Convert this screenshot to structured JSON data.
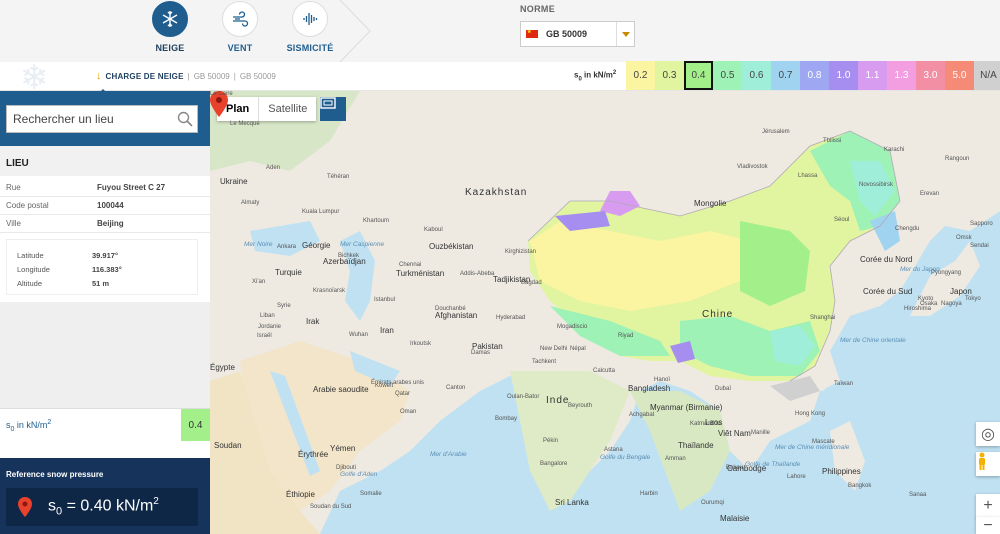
{
  "nav": {
    "items": [
      {
        "label": "NEIGE",
        "icon": "snowflake-icon",
        "active": true
      },
      {
        "label": "VENT",
        "icon": "wind-icon",
        "active": false
      },
      {
        "label": "SISMICITÉ",
        "icon": "seismic-wave-icon",
        "active": false
      }
    ]
  },
  "norme": {
    "label": "NORME",
    "selected": "GB 50009",
    "flag": "china-flag-icon"
  },
  "subbar": {
    "charge_label": "CHARGE DE NEIGE",
    "crumb1": "GB 50009",
    "crumb2": "GB 50009",
    "s0_unit_label": "s0 in kN/m2"
  },
  "legend": [
    {
      "value": "0.2",
      "color": "#fbf4a0"
    },
    {
      "value": "0.3",
      "color": "#e1f4a0"
    },
    {
      "value": "0.4",
      "color": "#a3f08a",
      "selected": true
    },
    {
      "value": "0.5",
      "color": "#9ef2b5"
    },
    {
      "value": "0.6",
      "color": "#9feed9"
    },
    {
      "value": "0.7",
      "color": "#9fd3ef"
    },
    {
      "value": "0.8",
      "color": "#9ea7f2"
    },
    {
      "value": "1.0",
      "color": "#a68ef0"
    },
    {
      "value": "1.1",
      "color": "#d79cf0"
    },
    {
      "value": "1.3",
      "color": "#f39ee0"
    },
    {
      "value": "3.0",
      "color": "#f38fa5"
    },
    {
      "value": "5.0",
      "color": "#f58a77"
    },
    {
      "value": "N/A",
      "color": "#d0d0d0"
    }
  ],
  "search": {
    "placeholder": "Rechercher un lieu"
  },
  "lieu": {
    "title": "LIEU",
    "rows": [
      {
        "key": "Rue",
        "value": "Fuyou Street C 27"
      },
      {
        "key": "Code postal",
        "value": "100044"
      },
      {
        "key": "Ville",
        "value": "Beijing"
      }
    ],
    "coords": [
      {
        "key": "Latitude",
        "value": "39.917°"
      },
      {
        "key": "Longitude",
        "value": "116.383°"
      },
      {
        "key": "Altitude",
        "value": "51 m"
      }
    ]
  },
  "result": {
    "s0_label": "s0 in kN/m2",
    "s0_value": "0.4",
    "reference_title": "Reference snow pressure",
    "reference_value": "s0 = 0.40 kN/m2"
  },
  "map": {
    "type_plan": "Plan",
    "type_satellite": "Satellite",
    "labels": [
      {
        "text": "Kazakhstan"
      },
      {
        "text": "Mongolie"
      },
      {
        "text": "Chine"
      },
      {
        "text": "Inde"
      },
      {
        "text": "Ukraine"
      },
      {
        "text": "Géorgie"
      },
      {
        "text": "Azerbaïdjan"
      },
      {
        "text": "Ouzbékistan"
      },
      {
        "text": "Turkménistan"
      },
      {
        "text": "Kirghizistan"
      },
      {
        "text": "Tadjikistan"
      },
      {
        "text": "Turquie"
      },
      {
        "text": "Syrie"
      },
      {
        "text": "Liban"
      },
      {
        "text": "Israël"
      },
      {
        "text": "Jordanie"
      },
      {
        "text": "Irak"
      },
      {
        "text": "Iran"
      },
      {
        "text": "Afghanistan"
      },
      {
        "text": "Pakistan"
      },
      {
        "text": "Égypte"
      },
      {
        "text": "Arabie saoudite"
      },
      {
        "text": "Koweït"
      },
      {
        "text": "Qatar"
      },
      {
        "text": "Émirats arabes unis"
      },
      {
        "text": "Oman"
      },
      {
        "text": "Soudan"
      },
      {
        "text": "Érythrée"
      },
      {
        "text": "Yémen"
      },
      {
        "text": "Djibouti"
      },
      {
        "text": "Éthiopie"
      },
      {
        "text": "Soudan du Sud"
      },
      {
        "text": "Somalie"
      },
      {
        "text": "Népal"
      },
      {
        "text": "New Delhi"
      },
      {
        "text": "Bangladesh"
      },
      {
        "text": "Myanmar (Birmanie)"
      },
      {
        "text": "Bombay"
      },
      {
        "text": "Bangalore"
      },
      {
        "text": "Sri Lanka"
      },
      {
        "text": "Thaïlande"
      },
      {
        "text": "Laos"
      },
      {
        "text": "Viêt Nam"
      },
      {
        "text": "Cambodge"
      },
      {
        "text": "Malaisie"
      },
      {
        "text": "Philippines"
      },
      {
        "text": "Taïwan"
      },
      {
        "text": "Hong Kong"
      },
      {
        "text": "Shanghai"
      },
      {
        "text": "Corée du Nord"
      },
      {
        "text": "Corée du Sud"
      },
      {
        "text": "Japon"
      },
      {
        "text": "Tokyo"
      },
      {
        "text": "Osaka"
      },
      {
        "text": "Kyoto"
      },
      {
        "text": "Hiroshima"
      },
      {
        "text": "Sapporo"
      },
      {
        "text": "Nagoya"
      },
      {
        "text": "Sendai"
      },
      {
        "text": "Mer Caspienne"
      },
      {
        "text": "Mer Noire"
      },
      {
        "text": "Mer du Japon"
      },
      {
        "text": "Mer de Chine orientale"
      },
      {
        "text": "Mer de Chine méridionale"
      },
      {
        "text": "Golfe du Bengale"
      },
      {
        "text": "Mer d'Arabie"
      },
      {
        "text": "Golfe de Thaïlande"
      },
      {
        "text": "Golfe d'Aden"
      },
      {
        "text": "Le Caire"
      },
      {
        "text": "Le Mecque"
      },
      {
        "text": "Téhéran"
      },
      {
        "text": "Kaboul"
      },
      {
        "text": "Bagdad"
      },
      {
        "text": "Riyad"
      },
      {
        "text": "Dubaï"
      },
      {
        "text": "Mascate"
      },
      {
        "text": "Sanaa"
      },
      {
        "text": "Aden"
      },
      {
        "text": "Khartoum"
      },
      {
        "text": "Addis-Abeba"
      },
      {
        "text": "Mogadiscio"
      },
      {
        "text": "Hanoï"
      },
      {
        "text": "Manille"
      },
      {
        "text": "Bangkok"
      },
      {
        "text": "Rangoun"
      },
      {
        "text": "Kuala Lumpur"
      },
      {
        "text": "Chennai"
      },
      {
        "text": "Hyderabad"
      },
      {
        "text": "Calcutta"
      },
      {
        "text": "Katmandou"
      },
      {
        "text": "Lahore"
      },
      {
        "text": "Karachi"
      },
      {
        "text": "Almaty"
      },
      {
        "text": "Bichkek"
      },
      {
        "text": "Douchanbé"
      },
      {
        "text": "Tachkent"
      },
      {
        "text": "Achgabat"
      },
      {
        "text": "Bakou"
      },
      {
        "text": "Tbilissi"
      },
      {
        "text": "Erevan"
      },
      {
        "text": "Ankara"
      },
      {
        "text": "Istanbul"
      },
      {
        "text": "Damas"
      },
      {
        "text": "Beyrouth"
      },
      {
        "text": "Amman"
      },
      {
        "text": "Jérusalem"
      },
      {
        "text": "Novossibirsk"
      },
      {
        "text": "Omsk"
      },
      {
        "text": "Krasnoïarsk"
      },
      {
        "text": "Irkoutsk"
      },
      {
        "text": "Oulan-Bator"
      },
      {
        "text": "Astana"
      },
      {
        "text": "Ourumqi"
      },
      {
        "text": "Lhassa"
      },
      {
        "text": "Chengdu"
      },
      {
        "text": "Xi'an"
      },
      {
        "text": "Wuhan"
      },
      {
        "text": "Canton"
      },
      {
        "text": "Pékin"
      },
      {
        "text": "Harbin"
      },
      {
        "text": "Vladivostok"
      },
      {
        "text": "Séoul"
      },
      {
        "text": "Pyongyang"
      }
    ]
  },
  "controls": {
    "zoom_in": "+",
    "zoom_out": "−"
  }
}
